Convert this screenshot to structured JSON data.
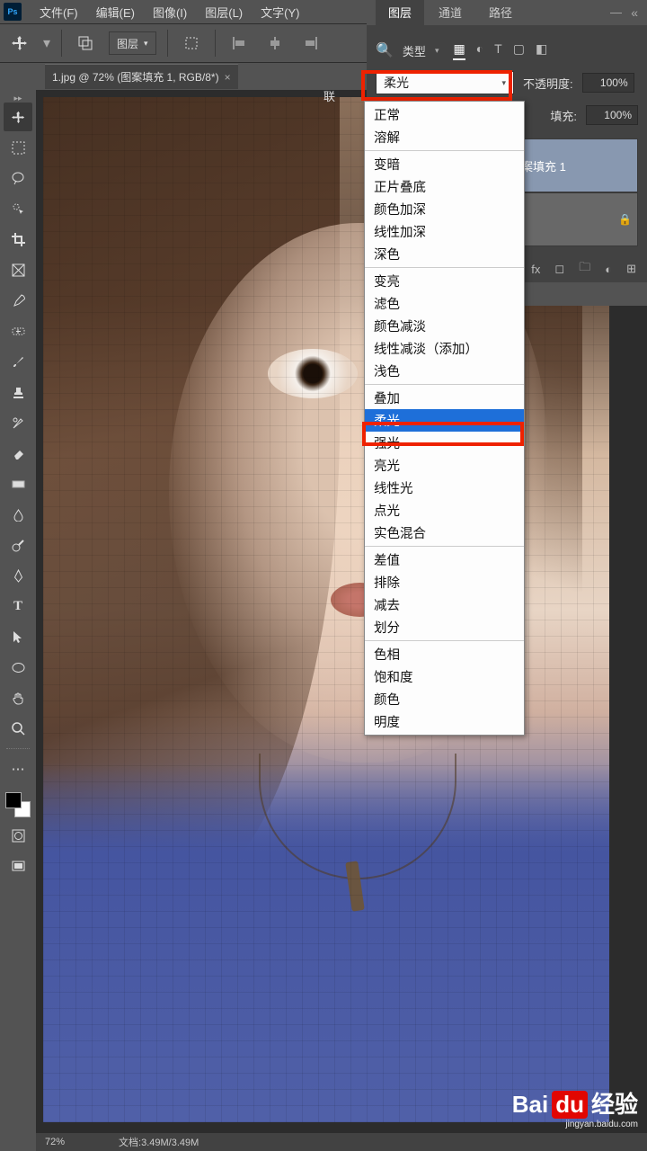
{
  "menubar": [
    "文件(F)",
    "编辑(E)",
    "图像(I)",
    "图层(L)",
    "文字(Y)"
  ],
  "options": {
    "layer_label": "图层"
  },
  "doc_tab": {
    "title": "1.jpg @ 72% (图案填充 1, RGB/8*)"
  },
  "panel": {
    "tabs": [
      "图层",
      "通道",
      "路径"
    ],
    "type_label": "类型",
    "blend_selected": "柔光",
    "opacity_label": "不透明度:",
    "opacity": "100%",
    "fill_label": "填充:",
    "fill": "100%",
    "layers": [
      {
        "name": "图案填充 1",
        "selected": true
      },
      {
        "name": "",
        "selected": false
      }
    ]
  },
  "blend_modes": {
    "groups": [
      [
        "正常",
        "溶解"
      ],
      [
        "变暗",
        "正片叠底",
        "颜色加深",
        "线性加深",
        "深色"
      ],
      [
        "变亮",
        "滤色",
        "颜色减淡",
        "线性减淡（添加）",
        "浅色"
      ],
      [
        "叠加",
        "柔光",
        "强光",
        "亮光",
        "线性光",
        "点光",
        "实色混合"
      ],
      [
        "差值",
        "排除",
        "减去",
        "划分"
      ],
      [
        "色相",
        "饱和度",
        "颜色",
        "明度"
      ]
    ],
    "hovered": "柔光"
  },
  "context_label": "联",
  "status": {
    "zoom": "72%",
    "doc": "文档:3.49M/3.49M"
  },
  "watermark": {
    "brand": "Bai",
    "brand2": "du",
    "suffix": "经验",
    "url": "jingyan.baidu.com"
  }
}
